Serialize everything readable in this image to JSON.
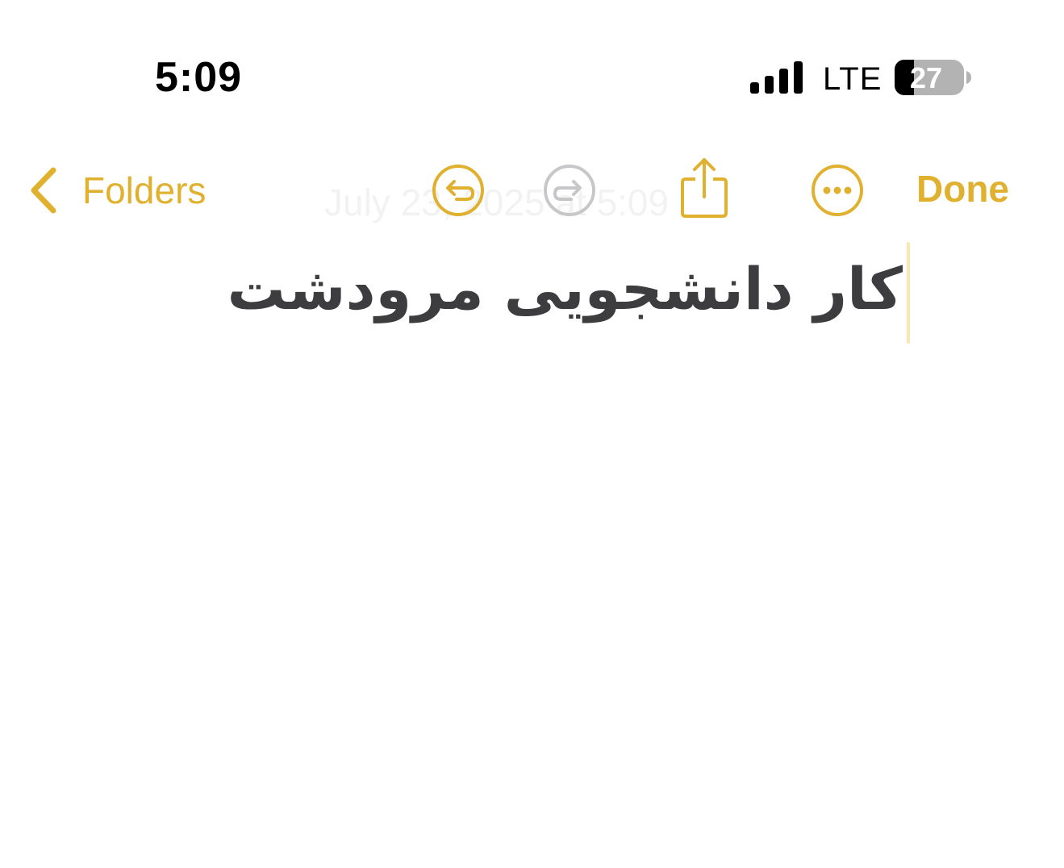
{
  "status_bar": {
    "time": "5:09",
    "network": "LTE",
    "battery": "27"
  },
  "toolbar": {
    "back_label": "Folders",
    "date_ghost": "July 23, 2025 at 5:09",
    "done_label": "Done"
  },
  "note": {
    "title": "کار دانشجویی مرودشت"
  },
  "colors": {
    "accent": "#DFB12F",
    "disabled": "#c7c7c9",
    "title_text": "#3d3d3f"
  },
  "icons": {
    "back": "chevron-left-icon",
    "undo": "undo-icon",
    "redo": "redo-icon",
    "share": "share-icon",
    "more": "ellipsis-icon",
    "signal": "signal-icon",
    "battery": "battery-icon"
  }
}
